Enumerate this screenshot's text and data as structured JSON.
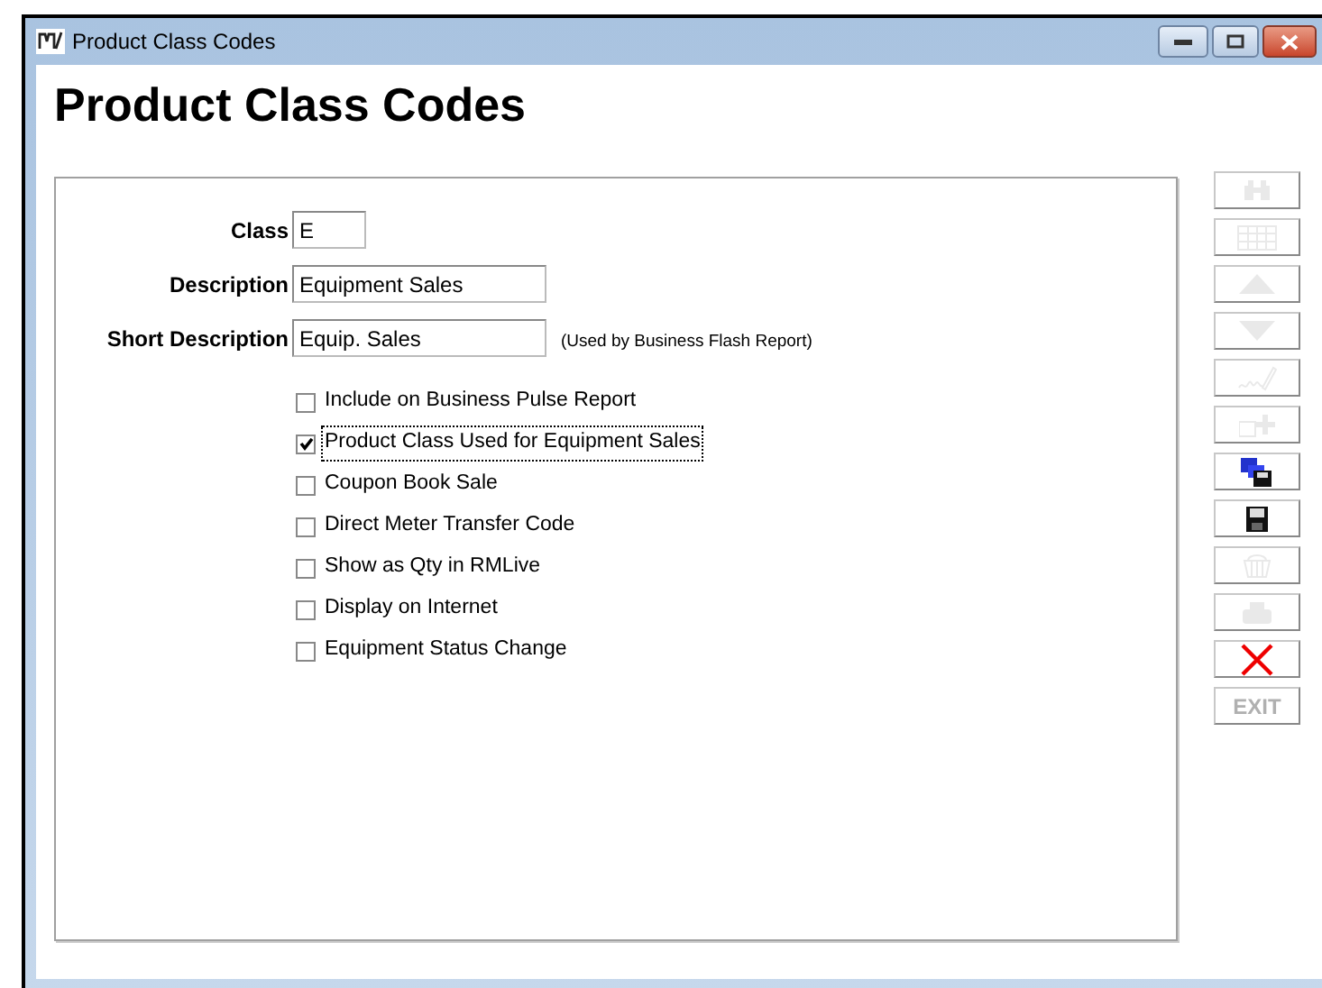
{
  "window": {
    "title": "Product Class Codes"
  },
  "heading": "Product Class Codes",
  "fields": [
    {
      "label": "Class",
      "value": "E"
    },
    {
      "label": "Description",
      "value": "Equipment Sales"
    },
    {
      "label": "Short Description",
      "value": "Equip. Sales",
      "note": "(Used by Business Flash Report)"
    }
  ],
  "checkboxes": [
    {
      "label": "Include on Business Pulse Report",
      "checked": false,
      "focused": false
    },
    {
      "label": "Product Class Used for Equipment Sales",
      "checked": true,
      "focused": true
    },
    {
      "label": "Coupon Book Sale",
      "checked": false,
      "focused": false
    },
    {
      "label": "Direct Meter Transfer Code",
      "checked": false,
      "focused": false
    },
    {
      "label": "Show as Qty in RMLive",
      "checked": false,
      "focused": false
    },
    {
      "label": "Display on Internet",
      "checked": false,
      "focused": false
    },
    {
      "label": "Equipment Status Change",
      "checked": false,
      "focused": false
    }
  ],
  "toolbar": [
    {
      "kind": "find",
      "disabled": true
    },
    {
      "kind": "grid",
      "disabled": true
    },
    {
      "kind": "up",
      "disabled": true
    },
    {
      "kind": "down",
      "disabled": true
    },
    {
      "kind": "sign",
      "disabled": true
    },
    {
      "kind": "add",
      "disabled": true
    },
    {
      "kind": "copy",
      "disabled": false
    },
    {
      "kind": "save",
      "disabled": false
    },
    {
      "kind": "basket",
      "disabled": true
    },
    {
      "kind": "print",
      "disabled": true
    },
    {
      "kind": "cancel",
      "disabled": false
    },
    {
      "kind": "exit",
      "disabled": true,
      "label": "EXIT"
    }
  ]
}
